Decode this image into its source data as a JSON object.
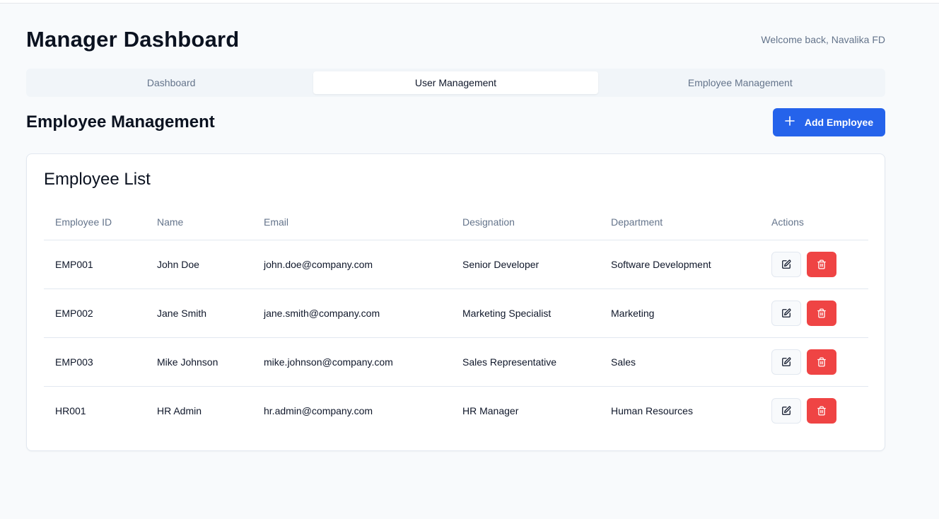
{
  "header": {
    "title": "Manager Dashboard",
    "welcome": "Welcome back, Navalika FD"
  },
  "tabs": [
    {
      "label": "Dashboard",
      "active": false
    },
    {
      "label": "User Management",
      "active": true
    },
    {
      "label": "Employee Management",
      "active": false
    }
  ],
  "section": {
    "title": "Employee Management",
    "add_button_label": "Add Employee",
    "add_button_icon": "plus-icon"
  },
  "card": {
    "title": "Employee List",
    "columns": [
      "Employee ID",
      "Name",
      "Email",
      "Designation",
      "Department",
      "Actions"
    ],
    "rows": [
      {
        "id": "EMP001",
        "name": "John Doe",
        "email": "john.doe@company.com",
        "designation": "Senior Developer",
        "department": "Software Development"
      },
      {
        "id": "EMP002",
        "name": "Jane Smith",
        "email": "jane.smith@company.com",
        "designation": "Marketing Specialist",
        "department": "Marketing"
      },
      {
        "id": "EMP003",
        "name": "Mike Johnson",
        "email": "mike.johnson@company.com",
        "designation": "Sales Representative",
        "department": "Sales"
      },
      {
        "id": "HR001",
        "name": "HR Admin",
        "email": "hr.admin@company.com",
        "designation": "HR Manager",
        "department": "Human Resources"
      }
    ],
    "row_actions": {
      "edit_icon": "edit-icon",
      "delete_icon": "trash-icon"
    }
  },
  "colors": {
    "accent": "#2563eb",
    "danger": "#ef4444",
    "background": "#f8fafc"
  }
}
